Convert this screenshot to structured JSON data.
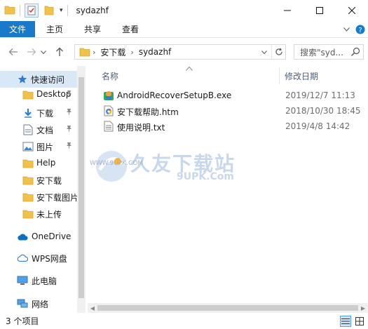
{
  "window": {
    "title": "sydazhf"
  },
  "ribbon": {
    "tabs": [
      {
        "label": "文件"
      },
      {
        "label": "主页"
      },
      {
        "label": "共享"
      },
      {
        "label": "查看"
      }
    ]
  },
  "address": {
    "crumbs": [
      "安下载",
      "sydazhf"
    ]
  },
  "search": {
    "placeholder": "搜索\"syd..."
  },
  "sidebar": {
    "items": [
      {
        "label": "快速访问",
        "icon": "star-icon",
        "pinned": false,
        "selected": true
      },
      {
        "label": "Desktop",
        "icon": "folder-icon",
        "pinned": true
      },
      {
        "label": "下载",
        "icon": "download-arrow-icon",
        "pinned": true
      },
      {
        "label": "文档",
        "icon": "document-icon",
        "pinned": true
      },
      {
        "label": "图片",
        "icon": "picture-icon",
        "pinned": true
      },
      {
        "label": "Help",
        "icon": "folder-icon",
        "pinned": false
      },
      {
        "label": "安下载",
        "icon": "folder-icon",
        "pinned": false
      },
      {
        "label": "安下载图片",
        "icon": "folder-icon",
        "pinned": false
      },
      {
        "label": "未上传",
        "icon": "folder-icon",
        "pinned": false
      },
      {
        "label": "OneDrive",
        "icon": "cloud-icon",
        "pinned": false
      },
      {
        "label": "WPS网盘",
        "icon": "wps-cloud-icon",
        "pinned": false
      },
      {
        "label": "此电脑",
        "icon": "computer-icon",
        "pinned": false
      },
      {
        "label": "网络",
        "icon": "network-icon",
        "pinned": false
      }
    ]
  },
  "columns": {
    "name": "名称",
    "modified": "修改日期"
  },
  "files": [
    {
      "name": "AndroidRecoverSetupB.exe",
      "modified": "2019/12/7 11:13",
      "icon": "installer-icon"
    },
    {
      "name": "安下载帮助.htm",
      "modified": "2018/10/30 18:45",
      "icon": "html-file-icon"
    },
    {
      "name": "使用说明.txt",
      "modified": "2019/4/8 14:42",
      "icon": "text-file-icon"
    }
  ],
  "watermark": {
    "title": "久友下载站",
    "www": "WWW.9UPK.COM",
    "sub": "9UPK.Com"
  },
  "status": {
    "count": "3 个项目"
  },
  "colors": {
    "accent": "#1979ca",
    "selected": "#d9e8f7",
    "folder": "#f0c24b"
  }
}
